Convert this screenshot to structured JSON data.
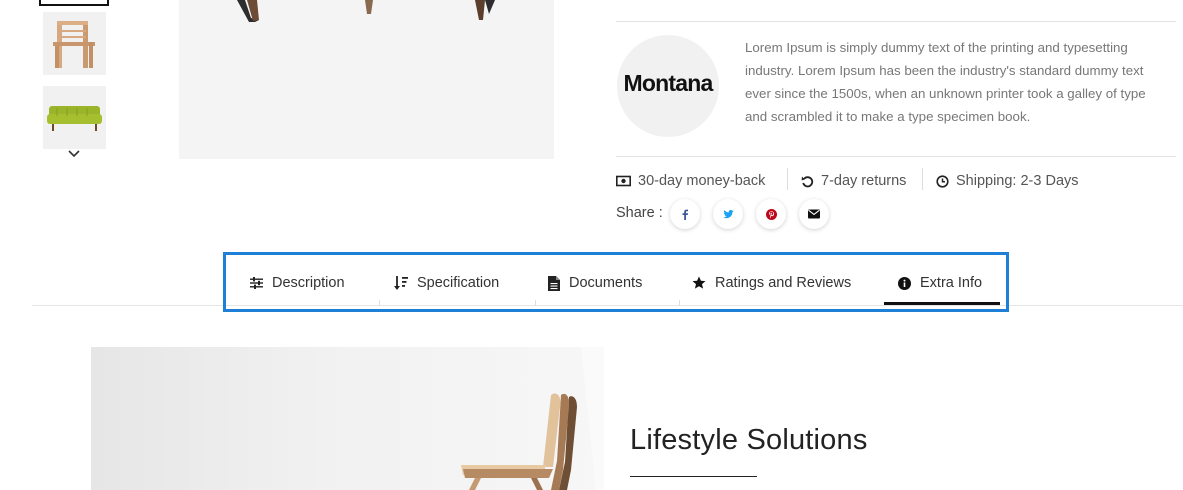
{
  "colors": {
    "accent_outline": "#1e7fd6",
    "pinterest": "#bd081c",
    "twitter": "#1da1f2",
    "facebook": "#3b5998"
  },
  "thumbnails": [
    {
      "name": "armchair-thumbnail"
    },
    {
      "name": "green-sofa-thumbnail"
    }
  ],
  "brand": {
    "logo_text": "Montana",
    "description": "Lorem Ipsum is simply dummy text of the printing and typesetting industry. Lorem Ipsum has been the industry's standard dummy text ever since the 1500s, when an unknown printer took a galley of type and scrambled it to make a type specimen book."
  },
  "features": [
    {
      "icon": "money-icon",
      "label": "30-day money-back"
    },
    {
      "icon": "return-icon",
      "label": "7-day returns"
    },
    {
      "icon": "clock-icon",
      "label": "Shipping: 2-3 Days"
    }
  ],
  "share": {
    "label": "Share :",
    "buttons": [
      "facebook-icon",
      "twitter-icon",
      "pinterest-icon",
      "email-icon"
    ]
  },
  "tabs": [
    {
      "icon": "sliders-icon",
      "label": "Description",
      "active": false
    },
    {
      "icon": "sort-icon",
      "label": "Specification",
      "active": false
    },
    {
      "icon": "document-icon",
      "label": "Documents",
      "active": false
    },
    {
      "icon": "star-icon",
      "label": "Ratings and Reviews",
      "active": false
    },
    {
      "icon": "info-icon",
      "label": "Extra Info",
      "active": true
    }
  ],
  "lifestyle": {
    "title": "Lifestyle Solutions"
  }
}
